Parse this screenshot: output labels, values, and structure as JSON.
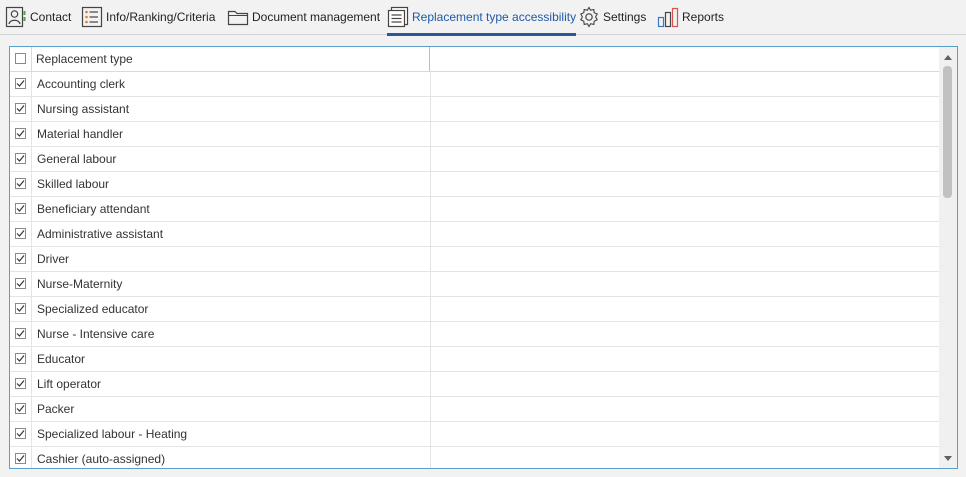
{
  "tabs": [
    {
      "label": "Contact",
      "icon": "contact-icon"
    },
    {
      "label": "Info/Ranking/Criteria",
      "icon": "list-icon"
    },
    {
      "label": "Document management",
      "icon": "folder-icon"
    },
    {
      "label": "Replacement type accessibility",
      "icon": "document-list-icon",
      "active": true
    },
    {
      "label": "Settings",
      "icon": "gear-icon"
    },
    {
      "label": "Reports",
      "icon": "bar-chart-icon"
    }
  ],
  "grid": {
    "column_header": "Replacement type",
    "header_checked": false,
    "rows": [
      {
        "label": "Accounting clerk",
        "checked": true
      },
      {
        "label": "Nursing assistant",
        "checked": true
      },
      {
        "label": "Material handler",
        "checked": true
      },
      {
        "label": "General labour",
        "checked": true
      },
      {
        "label": "Skilled labour",
        "checked": true
      },
      {
        "label": "Beneficiary attendant",
        "checked": true
      },
      {
        "label": "Administrative assistant",
        "checked": true
      },
      {
        "label": "Driver",
        "checked": true
      },
      {
        "label": "Nurse-Maternity",
        "checked": true
      },
      {
        "label": "Specialized educator",
        "checked": true
      },
      {
        "label": "Nurse - Intensive care",
        "checked": true
      },
      {
        "label": "Educator",
        "checked": true
      },
      {
        "label": "Lift operator",
        "checked": true
      },
      {
        "label": "Packer",
        "checked": true
      },
      {
        "label": "Specialized labour - Heating",
        "checked": true
      },
      {
        "label": "Cashier (auto-assigned)",
        "checked": true
      }
    ]
  },
  "colors": {
    "accent": "#2b5797",
    "panel_border": "#5a9ec9",
    "active_text": "#1e5aa8"
  }
}
